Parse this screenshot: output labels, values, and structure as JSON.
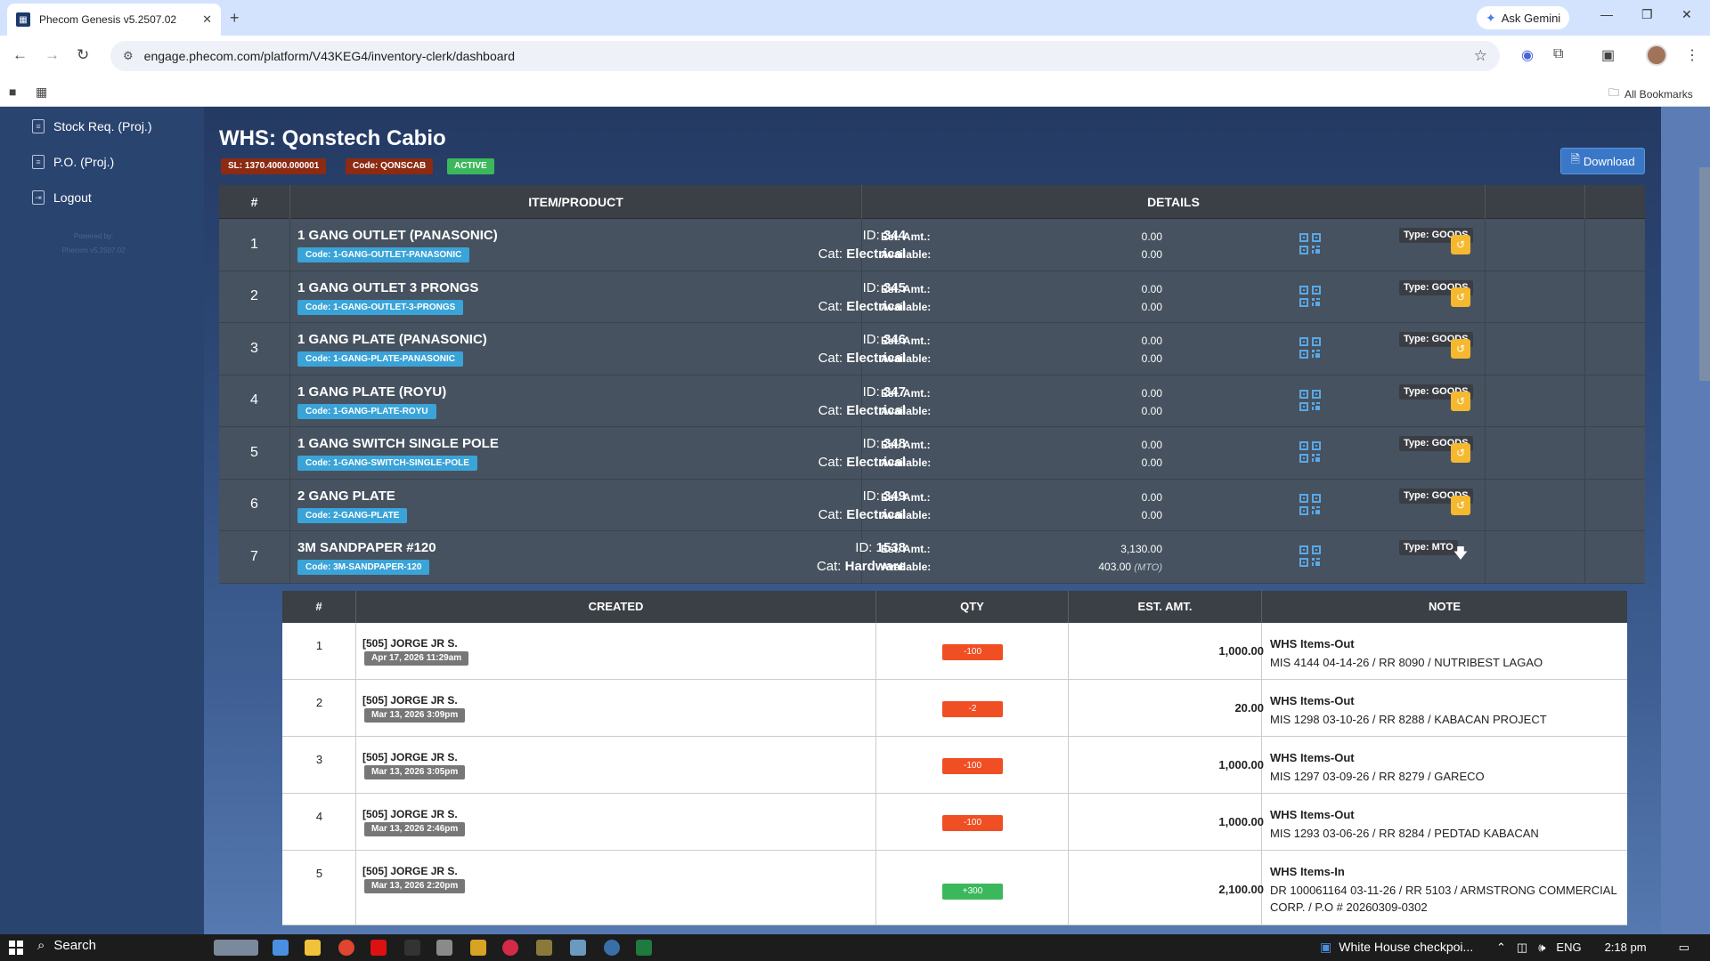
{
  "browser": {
    "tab_title": "Phecom Genesis v5.2507.02",
    "new_tab": "+",
    "gemini_label": "Ask Gemini",
    "url": "engage.phecom.com/platform/V43KEG4/inventory-clerk/dashboard",
    "bookmarks_label": "All Bookmarks"
  },
  "sidebar": {
    "items": [
      {
        "label": "Stock Req. (Proj.)",
        "icon": "document-icon"
      },
      {
        "label": "P.O. (Proj.)",
        "icon": "document-icon"
      },
      {
        "label": "Logout",
        "icon": "logout-icon"
      }
    ],
    "powered_by": "Powered by:",
    "powered_version": "Phecom v5.2507.02"
  },
  "header": {
    "title": "WHS: Qonstech Cabio",
    "sl_badge": "SL: 1370.4000.000001",
    "code_badge": "Code: QONSCAB",
    "status_badge": "ACTIVE",
    "download_label": "Download"
  },
  "inventory": {
    "columns": [
      "#",
      "ITEM/PRODUCT",
      "DETAILS"
    ],
    "est_label": "Est. Amt.:",
    "available_label": "Available:",
    "rows": [
      {
        "num": "1",
        "name": "1 GANG OUTLET (PANASONIC)",
        "code": "Code: 1-GANG-OUTLET-PANASONIC",
        "id_label": "ID:",
        "id": "344",
        "cat_label": "Cat:",
        "cat": "Electrical",
        "est": "0.00",
        "available": "0.00",
        "available_note": "",
        "type": "Type: GOODS"
      },
      {
        "num": "2",
        "name": "1 GANG OUTLET 3 PRONGS",
        "code": "Code: 1-GANG-OUTLET-3-PRONGS",
        "id_label": "ID:",
        "id": "345",
        "cat_label": "Cat:",
        "cat": "Electrical",
        "est": "0.00",
        "available": "0.00",
        "available_note": "",
        "type": "Type: GOODS"
      },
      {
        "num": "3",
        "name": "1 GANG PLATE (PANASONIC)",
        "code": "Code: 1-GANG-PLATE-PANASONIC",
        "id_label": "ID:",
        "id": "346",
        "cat_label": "Cat:",
        "cat": "Electrical",
        "est": "0.00",
        "available": "0.00",
        "available_note": "",
        "type": "Type: GOODS"
      },
      {
        "num": "4",
        "name": "1 GANG PLATE (ROYU)",
        "code": "Code: 1-GANG-PLATE-ROYU",
        "id_label": "ID:",
        "id": "347",
        "cat_label": "Cat:",
        "cat": "Electrical",
        "est": "0.00",
        "available": "0.00",
        "available_note": "",
        "type": "Type: GOODS"
      },
      {
        "num": "5",
        "name": "1 GANG SWITCH SINGLE POLE",
        "code": "Code: 1-GANG-SWITCH-SINGLE-POLE",
        "id_label": "ID:",
        "id": "348",
        "cat_label": "Cat:",
        "cat": "Electrical",
        "est": "0.00",
        "available": "0.00",
        "available_note": "",
        "type": "Type: GOODS"
      },
      {
        "num": "6",
        "name": "2 GANG PLATE",
        "code": "Code: 2-GANG-PLATE",
        "id_label": "ID:",
        "id": "349",
        "cat_label": "Cat:",
        "cat": "Electrical",
        "est": "0.00",
        "available": "0.00",
        "available_note": "",
        "type": "Type: GOODS"
      },
      {
        "num": "7",
        "name": "3M SANDPAPER #120",
        "code": "Code: 3M-SANDPAPER-120",
        "id_label": "ID:",
        "id": "1538",
        "cat_label": "Cat:",
        "cat": "Hardware",
        "est": "3,130.00",
        "available": "403.00",
        "available_note": "(MTO)",
        "type": "Type: MTO"
      }
    ]
  },
  "detail": {
    "columns": [
      "#",
      "CREATED",
      "QTY",
      "EST. AMT.",
      "NOTE"
    ],
    "rows": [
      {
        "num": "1",
        "user": "[505] JORGE JR S.",
        "date": "Apr 17, 2026 11:29am",
        "qty": "-100",
        "qty_color": "#f04e23",
        "amt": "1,000.00",
        "note_title": "WHS Items-Out",
        "note": "MIS 4144 04-14-26 / RR 8090 / NUTRIBEST LAGAO"
      },
      {
        "num": "2",
        "user": "[505] JORGE JR S.",
        "date": "Mar 13, 2026 3:09pm",
        "qty": "-2",
        "qty_color": "#f04e23",
        "amt": "20.00",
        "note_title": "WHS Items-Out",
        "note": "MIS 1298 03-10-26 / RR 8288 / KABACAN PROJECT"
      },
      {
        "num": "3",
        "user": "[505] JORGE JR S.",
        "date": "Mar 13, 2026 3:05pm",
        "qty": "-100",
        "qty_color": "#f04e23",
        "amt": "1,000.00",
        "note_title": "WHS Items-Out",
        "note": "MIS 1297 03-09-26 / RR 8279 / GARECO"
      },
      {
        "num": "4",
        "user": "[505] JORGE JR S.",
        "date": "Mar 13, 2026 2:46pm",
        "qty": "-100",
        "qty_color": "#f04e23",
        "amt": "1,000.00",
        "note_title": "WHS Items-Out",
        "note": "MIS 1293 03-06-26 / RR 8284 / PEDTAD KABACAN"
      },
      {
        "num": "5",
        "user": "[505] JORGE JR S.",
        "date": "Mar 13, 2026 2:20pm",
        "qty": "+300",
        "qty_color": "#3cb85c",
        "amt": "2,100.00",
        "note_title": "WHS Items-In",
        "note": "DR 100061164 03-11-26 / RR 5103 / ARMSTRONG COMMERCIAL CORP. / P.O # 20260309-0302"
      }
    ]
  },
  "taskbar": {
    "search_label": "Search",
    "news": "White House checkpoi...",
    "lang": "ENG",
    "time": "2:18 pm"
  }
}
